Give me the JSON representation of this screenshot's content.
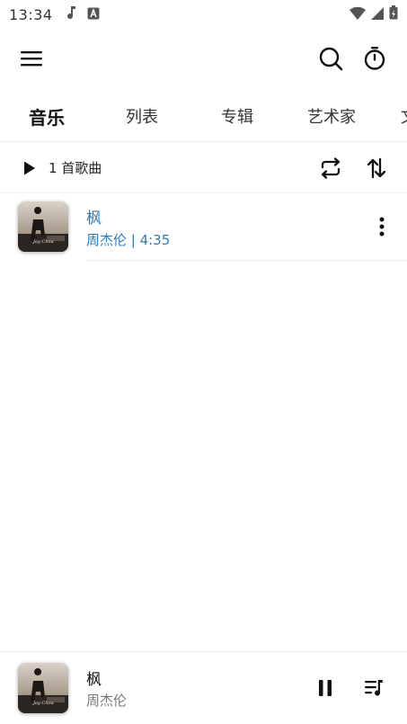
{
  "status_bar": {
    "time": "13:34",
    "icons": [
      "music-note-icon",
      "text-a-icon",
      "wifi-icon",
      "signal-icon",
      "battery-icon"
    ]
  },
  "app_bar": {
    "icons": [
      "menu-icon",
      "search-icon",
      "timer-icon"
    ]
  },
  "tabs": [
    {
      "label": "音乐",
      "active": true
    },
    {
      "label": "列表",
      "active": false
    },
    {
      "label": "专辑",
      "active": false
    },
    {
      "label": "艺术家",
      "active": false
    },
    {
      "label": "文",
      "active": false
    }
  ],
  "list_header": {
    "count_label": "1 首歌曲",
    "icons": [
      "play-icon",
      "repeat-icon",
      "sort-icon"
    ]
  },
  "songs": [
    {
      "title": "枫",
      "subtitle": "周杰伦 | 4:35",
      "cover_icon": "album-cover"
    }
  ],
  "mini_player": {
    "title": "枫",
    "artist": "周杰伦",
    "icons": [
      "pause-icon",
      "queue-icon"
    ]
  },
  "colors": {
    "accent": "#2f7ab8",
    "text_primary": "#111111",
    "text_secondary": "#777777",
    "divider": "#ececec"
  }
}
